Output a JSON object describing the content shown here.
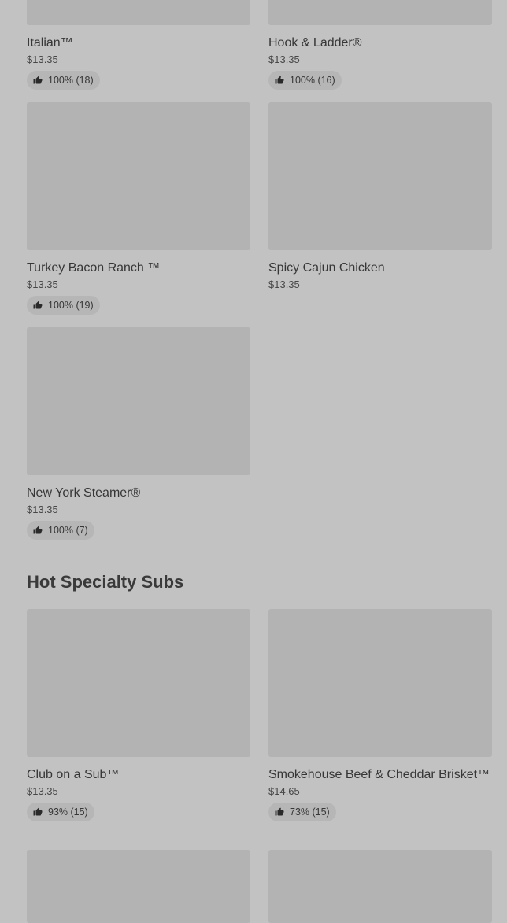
{
  "items_top": [
    {
      "name": "Italian™",
      "price": "$13.35",
      "rating": "100% (18)"
    },
    {
      "name": "Hook & Ladder®",
      "price": "$13.35",
      "rating": "100% (16)"
    },
    {
      "name": "Turkey Bacon Ranch ™",
      "price": "$13.35",
      "rating": "100% (19)"
    },
    {
      "name": "Spicy Cajun Chicken",
      "price": "$13.35"
    },
    {
      "name": "New York Steamer®",
      "price": "$13.35",
      "rating": "100% (7)"
    }
  ],
  "hot_section": {
    "title": "Hot Specialty Subs",
    "items": [
      {
        "name": "Club on a Sub™",
        "price": "$13.35",
        "rating": "93% (15)"
      },
      {
        "name": "Smokehouse Beef & Cheddar Brisket™",
        "price": "$14.65",
        "rating": "73% (15)"
      }
    ]
  },
  "icons": {
    "rating": "thumbs-up-icon"
  }
}
